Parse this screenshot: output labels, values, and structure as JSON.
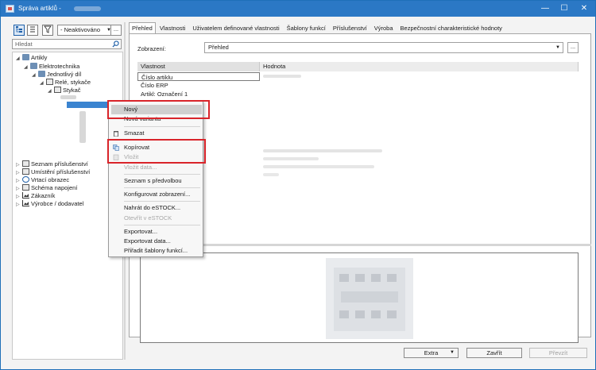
{
  "window": {
    "title": "Správa artiklů -"
  },
  "window_controls": {
    "minimize": "—",
    "maximize": "☐",
    "close": "✕"
  },
  "left_toolbar": {
    "filter_value": "- Neaktivováno",
    "more_label": "...",
    "search_placeholder": "Hledat"
  },
  "tree": {
    "items": [
      {
        "label": "Artikly",
        "arrow": "◢"
      },
      {
        "label": "Elektrotechnika",
        "arrow": "◢"
      },
      {
        "label": "Jednotlivý díl",
        "arrow": "◢"
      },
      {
        "label": "Relé, stykače",
        "arrow": "◢"
      },
      {
        "label": "Stykač",
        "arrow": "◢"
      },
      {
        "label": "Seznam příslušenství",
        "arrow": "▷"
      },
      {
        "label": "Umístění příslušenství",
        "arrow": "▷"
      },
      {
        "label": "Vrtací obrazec",
        "arrow": "▷"
      },
      {
        "label": "Schéma napojení",
        "arrow": "▷"
      },
      {
        "label": "Zákazník",
        "arrow": "▷"
      },
      {
        "label": "Výrobce / dodavatel",
        "arrow": "▷"
      }
    ]
  },
  "tabs": [
    {
      "label": "Přehled"
    },
    {
      "label": "Vlastnosti"
    },
    {
      "label": "Uživatelem definované vlastnosti"
    },
    {
      "label": "Šablony funkcí"
    },
    {
      "label": "Příslušenství"
    },
    {
      "label": "Výroba"
    },
    {
      "label": "Bezpečnostní charakteristické hodnoty"
    }
  ],
  "overview": {
    "display_label": "Zobrazení:",
    "display_value": "Přehled",
    "more_label": "..."
  },
  "grid": {
    "headers": {
      "property": "Vlastnost",
      "value": "Hodnota"
    },
    "rows": [
      {
        "property": "Číslo artiklu"
      },
      {
        "property": "Číslo ERP"
      },
      {
        "property": "Artikl: Označení 1"
      }
    ]
  },
  "context_menu": {
    "items": [
      {
        "label": "Nový",
        "enabled": true
      },
      {
        "label": "Nová varianta",
        "enabled": true
      },
      {
        "label": "Smazat",
        "enabled": true
      },
      {
        "label": "Kopírovat",
        "enabled": true
      },
      {
        "label": "Vložit",
        "enabled": false
      },
      {
        "label": "Vložit data...",
        "enabled": false
      },
      {
        "label": "Seznam s předvolbou",
        "enabled": true
      },
      {
        "label": "Konfigurovat zobrazení...",
        "enabled": true
      },
      {
        "label": "Nahrát do eSTOCK...",
        "enabled": true
      },
      {
        "label": "Otevřít v eSTOCK",
        "enabled": false
      },
      {
        "label": "Exportovat...",
        "enabled": true
      },
      {
        "label": "Exportovat data...",
        "enabled": true
      },
      {
        "label": "Přiřadit šablony funkcí...",
        "enabled": true
      }
    ]
  },
  "footer": {
    "extra_label": "Extra",
    "extra_arrow": "▼",
    "close_label": "Zavřít",
    "apply_label": "Převzít"
  },
  "colors": {
    "titlebar": "#2b78c5",
    "selection": "#3a84d0",
    "highlight_box": "#d9242a"
  }
}
